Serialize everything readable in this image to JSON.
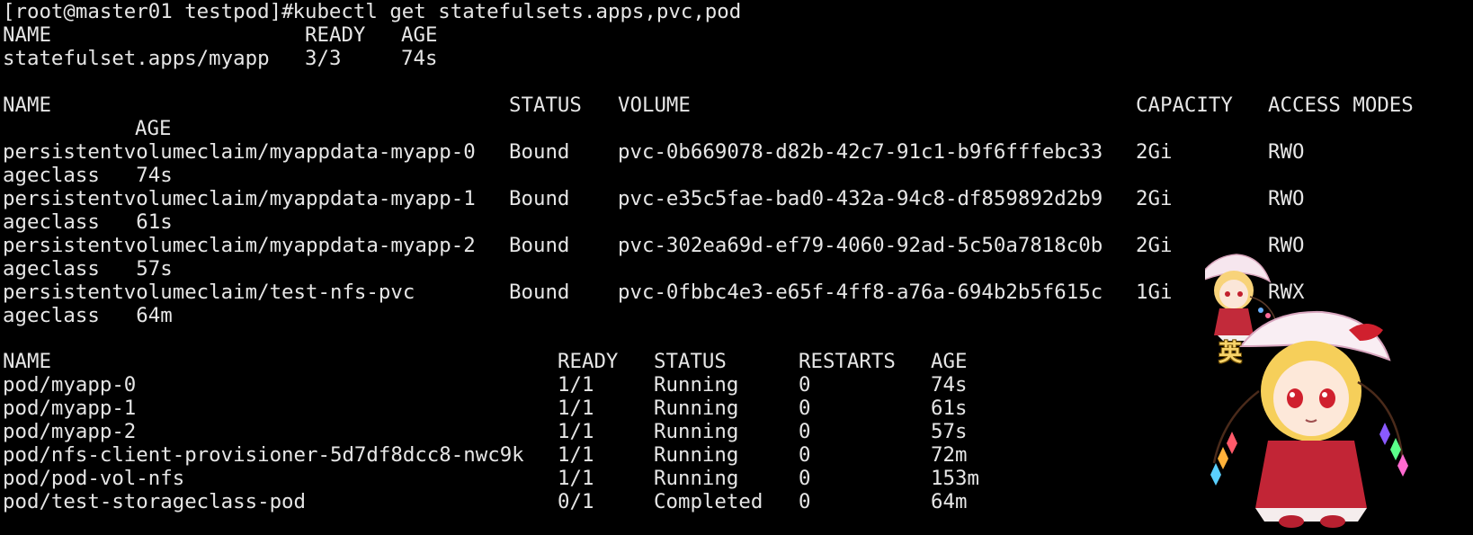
{
  "terminal": {
    "prompt": "[root@master01 testpod]#",
    "command": " kubectl get statefulsets.apps,pvc,pod",
    "statefulsets": {
      "headers": [
        "NAME",
        "READY",
        "AGE"
      ],
      "rows": [
        [
          "statefulset.apps/myapp",
          "3/3",
          "74s"
        ]
      ]
    },
    "pvcs": {
      "headers": [
        "NAME",
        "STATUS",
        "VOLUME",
        "CAPACITY",
        "ACCESS MODES"
      ],
      "header_wrap": "AGE",
      "rows": [
        {
          "name": "persistentvolumeclaim/myappdata-myapp-0",
          "status": "Bound",
          "volume": "pvc-0b669078-d82b-42c7-91c1-b9f6fffebc33",
          "capacity": "2Gi",
          "access": "RWO",
          "wrap": "ageclass   74s"
        },
        {
          "name": "persistentvolumeclaim/myappdata-myapp-1",
          "status": "Bound",
          "volume": "pvc-e35c5fae-bad0-432a-94c8-df859892d2b9",
          "capacity": "2Gi",
          "access": "RWO",
          "wrap": "ageclass   61s"
        },
        {
          "name": "persistentvolumeclaim/myappdata-myapp-2",
          "status": "Bound",
          "volume": "pvc-302ea69d-ef79-4060-92ad-5c50a7818c0b",
          "capacity": "2Gi",
          "access": "RWO",
          "wrap": "ageclass   57s"
        },
        {
          "name": "persistentvolumeclaim/test-nfs-pvc",
          "status": "Bound",
          "volume": "pvc-0fbbc4e3-e65f-4ff8-a76a-694b2b5f615c",
          "capacity": "1Gi",
          "access": "RWX",
          "wrap": "ageclass   64m"
        }
      ]
    },
    "pods": {
      "headers": [
        "NAME",
        "READY",
        "STATUS",
        "RESTARTS",
        "AGE"
      ],
      "rows": [
        [
          "pod/myapp-0",
          "1/1",
          "Running",
          "0",
          "74s"
        ],
        [
          "pod/myapp-1",
          "1/1",
          "Running",
          "0",
          "61s"
        ],
        [
          "pod/myapp-2",
          "1/1",
          "Running",
          "0",
          "57s"
        ],
        [
          "pod/nfs-client-provisioner-5d7df8dcc8-nwc9k",
          "1/1",
          "Running",
          "0",
          "72m"
        ],
        [
          "pod/pod-vol-nfs",
          "1/1",
          "Running",
          "0",
          "153m"
        ],
        [
          "pod/test-storageclass-pod",
          "0/1",
          "Completed",
          "0",
          "64m"
        ]
      ]
    }
  },
  "overlay": {
    "ime_label": "英"
  },
  "colors": {
    "background": "#000000",
    "text": "#e6e6e6"
  }
}
